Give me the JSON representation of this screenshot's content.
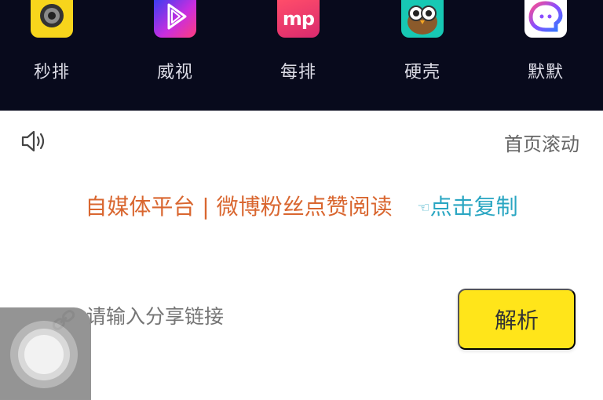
{
  "apps": [
    {
      "label": "秒排",
      "icon": "camera-icon",
      "color": "#f7d51c"
    },
    {
      "label": "威视",
      "icon": "play-icon",
      "color": "#7b3cf2"
    },
    {
      "label": "每排",
      "icon": "mp-icon",
      "color": "#f03a5f",
      "glyph": "mp"
    },
    {
      "label": "硬壳",
      "icon": "owl-icon",
      "color": "#17c8b4"
    },
    {
      "label": "默默",
      "icon": "chat-face-icon",
      "color": "#ffffff"
    }
  ],
  "announcement": {
    "text": "首页滚动"
  },
  "promo": {
    "text": "自媒体平台 | 微博粉丝点赞阅读",
    "copy_label": "点击复制"
  },
  "share": {
    "placeholder": "请输入分享链接",
    "button_label": "解析"
  }
}
